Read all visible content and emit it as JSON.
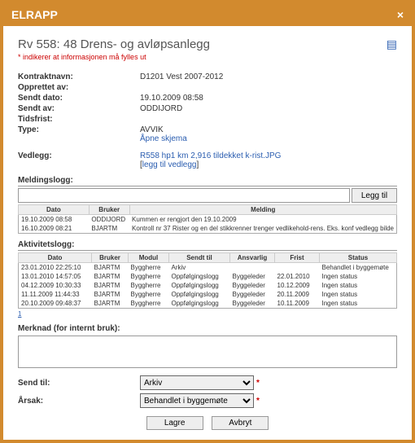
{
  "window": {
    "title": "ELRAPP"
  },
  "header": {
    "title": "Rv 558: 48 Drens- og avløpsanlegg",
    "required_note": "* indikerer at informasjonen må fylles ut"
  },
  "meta": {
    "kontraktnavn_label": "Kontraktnavn:",
    "kontraktnavn_value": "D1201 Vest 2007-2012",
    "opprettet_label": "Opprettet av:",
    "opprettet_value": "",
    "sendt_dato_label": "Sendt dato:",
    "sendt_dato_value": "19.10.2009 08:58",
    "sendt_av_label": "Sendt av:",
    "sendt_av_value": "ODDIJORD",
    "tidsfrist_label": "Tidsfrist:",
    "tidsfrist_value": "",
    "type_label": "Type:",
    "type_value": "AVVIK",
    "apne_skjema": "Åpne skjema",
    "vedlegg_label": "Vedlegg:",
    "vedlegg_file": "R558 hp1 km 2,916 tildekket k-rist.JPG",
    "legg_til_vedlegg": "legg til vedlegg"
  },
  "meldingslogg": {
    "label": "Meldingslogg:",
    "add_button": "Legg til",
    "input_value": "",
    "cols": {
      "dato": "Dato",
      "bruker": "Bruker",
      "melding": "Melding"
    },
    "rows": [
      {
        "dato": "19.10.2009 08:58",
        "bruker": "ODDIJORD",
        "melding": "Kummen er rengjort den 19.10.2009"
      },
      {
        "dato": "16.10.2009 08:21",
        "bruker": "BJARTM",
        "melding": "Kontroll nr 37 Rister og en del stikkrenner trenger vedlikehold-rens. Eks. konf vedlegg bilde"
      }
    ]
  },
  "aktivitetslogg": {
    "label": "Aktivitetslogg:",
    "cols": {
      "dato": "Dato",
      "bruker": "Bruker",
      "modul": "Modul",
      "sendt_til": "Sendt til",
      "ansvarlig": "Ansvarlig",
      "frist": "Frist",
      "status": "Status"
    },
    "rows": [
      {
        "dato": "23.01.2010 22:25:10",
        "bruker": "BJARTM",
        "modul": "Byggherre",
        "sendt_til": "Arkiv",
        "ansvarlig": "",
        "frist": "",
        "status": "Behandlet i byggemøte"
      },
      {
        "dato": "13.01.2010 14:57:05",
        "bruker": "BJARTM",
        "modul": "Byggherre",
        "sendt_til": "Oppfølgingslogg",
        "ansvarlig": "Byggeleder",
        "frist": "22.01.2010",
        "status": "Ingen status"
      },
      {
        "dato": "04.12.2009 10:30:33",
        "bruker": "BJARTM",
        "modul": "Byggherre",
        "sendt_til": "Oppfølgingslogg",
        "ansvarlig": "Byggeleder",
        "frist": "10.12.2009",
        "status": "Ingen status"
      },
      {
        "dato": "11.11.2009 11:44:33",
        "bruker": "BJARTM",
        "modul": "Byggherre",
        "sendt_til": "Oppfølgingslogg",
        "ansvarlig": "Byggeleder",
        "frist": "20.11.2009",
        "status": "Ingen status"
      },
      {
        "dato": "20.10.2009 09:48:37",
        "bruker": "BJARTM",
        "modul": "Byggherre",
        "sendt_til": "Oppfølgingslogg",
        "ansvarlig": "Byggeleder",
        "frist": "10.11.2009",
        "status": "Ingen status"
      }
    ],
    "nav": "1"
  },
  "merknad": {
    "label": "Merknad (for internt bruk):",
    "value": ""
  },
  "form": {
    "send_til_label": "Send til:",
    "send_til_value": "Arkiv",
    "arsak_label": "Årsak:",
    "arsak_value": "Behandlet i byggemøte"
  },
  "buttons": {
    "lagre": "Lagre",
    "avbryt": "Avbryt"
  }
}
